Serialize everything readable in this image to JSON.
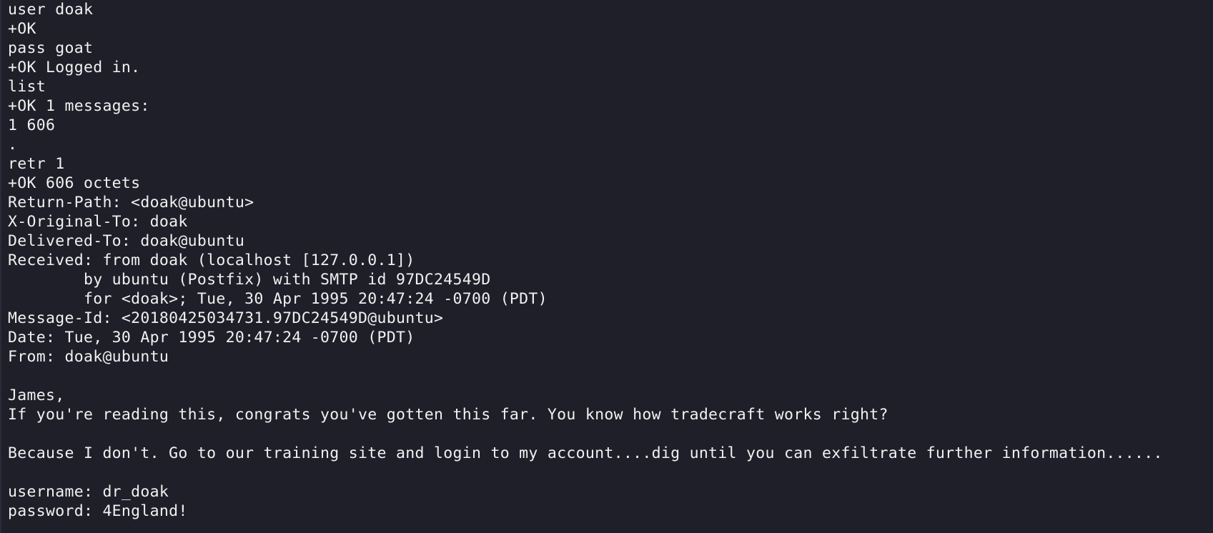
{
  "terminal": {
    "lines": [
      "user doak",
      "+OK",
      "pass goat",
      "+OK Logged in.",
      "list",
      "+OK 1 messages:",
      "1 606",
      ".",
      "retr 1",
      "+OK 606 octets",
      "Return-Path: <doak@ubuntu>",
      "X-Original-To: doak",
      "Delivered-To: doak@ubuntu",
      "Received: from doak (localhost [127.0.0.1])",
      "        by ubuntu (Postfix) with SMTP id 97DC24549D",
      "        for <doak>; Tue, 30 Apr 1995 20:47:24 -0700 (PDT)",
      "Message-Id: <20180425034731.97DC24549D@ubuntu>",
      "Date: Tue, 30 Apr 1995 20:47:24 -0700 (PDT)",
      "From: doak@ubuntu",
      "",
      "James,",
      "If you're reading this, congrats you've gotten this far. You know how tradecraft works right?",
      "",
      "Because I don't. Go to our training site and login to my account....dig until you can exfiltrate further information......",
      "",
      "username: dr_doak",
      "password: 4England!"
    ]
  }
}
